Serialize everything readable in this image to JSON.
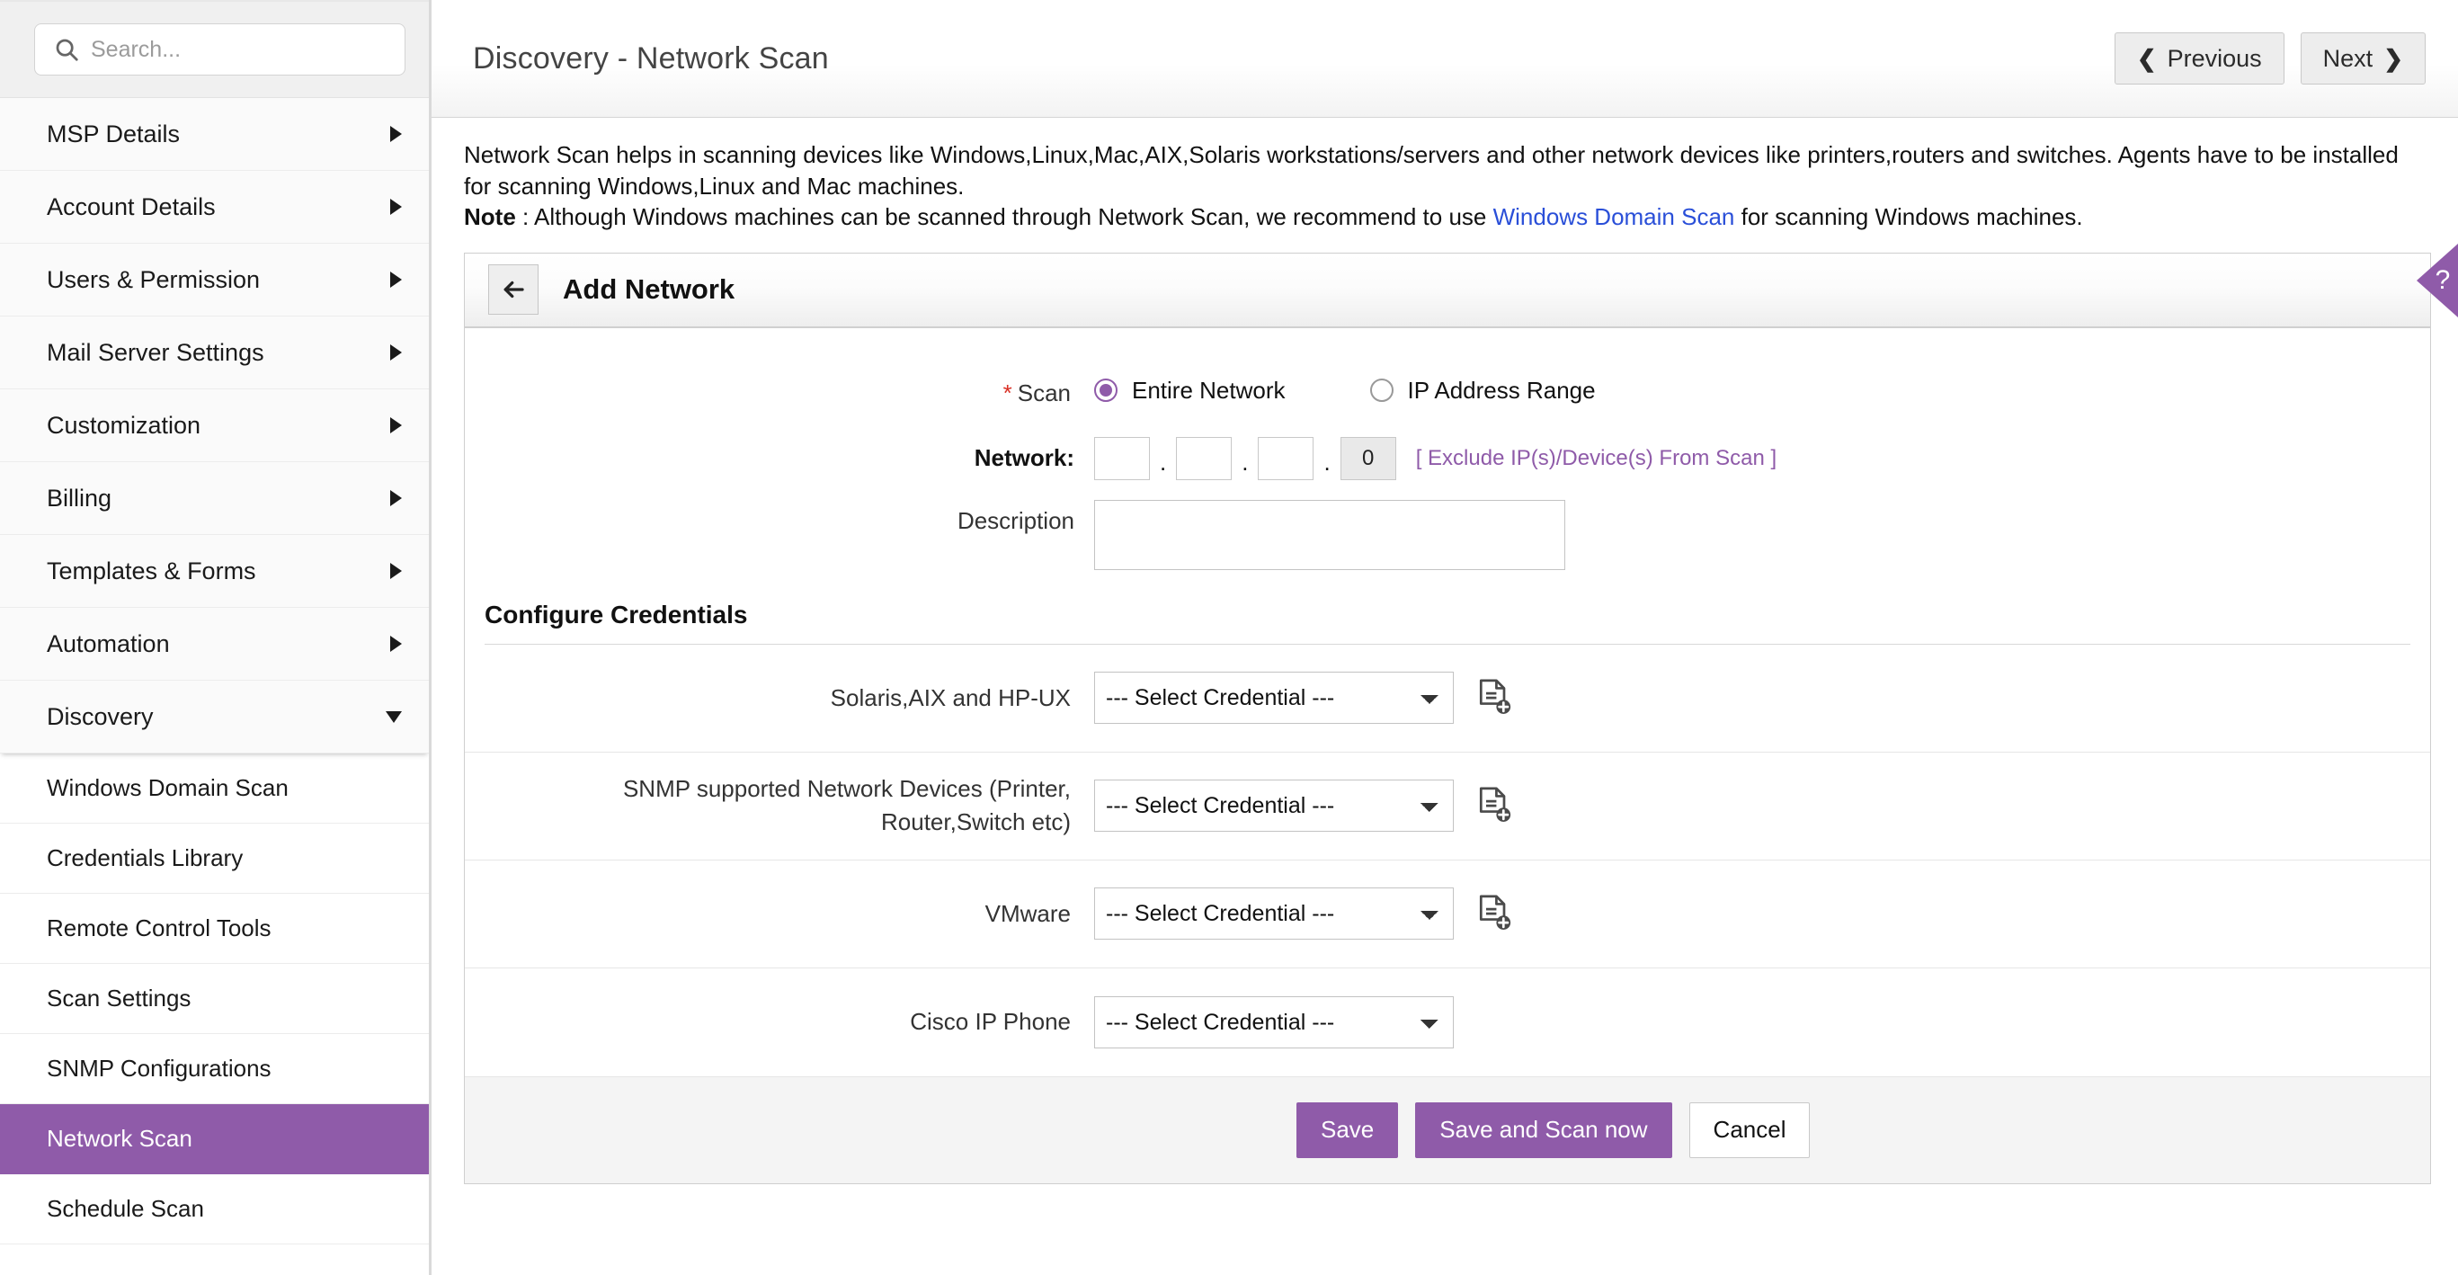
{
  "sidebar": {
    "search": {
      "placeholder": "Search...",
      "value": ""
    },
    "groups": [
      {
        "label": "MSP Details",
        "expanded": false
      },
      {
        "label": "Account Details",
        "expanded": false
      },
      {
        "label": "Users & Permission",
        "expanded": false
      },
      {
        "label": "Mail Server Settings",
        "expanded": false
      },
      {
        "label": "Customization",
        "expanded": false
      },
      {
        "label": "Billing",
        "expanded": false
      },
      {
        "label": "Templates & Forms",
        "expanded": false
      },
      {
        "label": "Automation",
        "expanded": false
      },
      {
        "label": "Discovery",
        "expanded": true
      }
    ],
    "discovery_items": [
      {
        "label": "Windows Domain Scan",
        "active": false
      },
      {
        "label": "Credentials Library",
        "active": false
      },
      {
        "label": "Remote Control Tools",
        "active": false
      },
      {
        "label": "Scan Settings",
        "active": false
      },
      {
        "label": "SNMP Configurations",
        "active": false
      },
      {
        "label": "Network Scan",
        "active": true
      },
      {
        "label": "Schedule Scan",
        "active": false
      }
    ]
  },
  "topbar": {
    "title": "Discovery - Network Scan",
    "previous_label": "Previous",
    "next_label": "Next",
    "previous_chevron": "❮",
    "next_chevron": "❯"
  },
  "help_tab": {
    "glyph": "?"
  },
  "intro": {
    "line1": "Network Scan helps in scanning devices like Windows,Linux,Mac,AIX,Solaris workstations/servers and other network devices like printers,routers and switches. Agents have to be installed for scanning Windows,Linux and Mac machines.",
    "note_label": "Note",
    "note_before": " : Although Windows machines can be scanned through Network Scan, we recommend to use ",
    "note_link": "Windows Domain Scan",
    "note_after": " for scanning Windows machines."
  },
  "card": {
    "title": "Add Network",
    "back_icon": "arrow-left-icon",
    "scan": {
      "label": "Scan",
      "required_mark": "*",
      "options": [
        {
          "label": "Entire Network",
          "selected": true
        },
        {
          "label": "IP Address Range",
          "selected": false
        }
      ]
    },
    "network": {
      "label": "Network:",
      "octets": [
        "",
        "",
        "",
        "0"
      ],
      "separator": ".",
      "exclude_link": "[ Exclude IP(s)/Device(s) From Scan ]"
    },
    "description": {
      "label": "Description",
      "value": "",
      "placeholder": ""
    },
    "credentials_section_title": "Configure Credentials",
    "credentials": [
      {
        "label": "Solaris,AIX and HP-UX",
        "value": "--- Select Credential ---",
        "has_add_icon": true
      },
      {
        "label": "SNMP supported Network Devices (Printer, Router,Switch etc)",
        "value": "--- Select Credential ---",
        "has_add_icon": true
      },
      {
        "label": "VMware",
        "value": "--- Select Credential ---",
        "has_add_icon": true
      },
      {
        "label": "Cisco IP Phone",
        "value": "--- Select Credential ---",
        "has_add_icon": false
      }
    ],
    "select_options": [
      "--- Select Credential ---"
    ],
    "footer": {
      "save_label": "Save",
      "save_scan_label": "Save and Scan now",
      "cancel_label": "Cancel"
    }
  },
  "colors": {
    "accent_purple": "#8f5ba9",
    "required_red": "#d93025",
    "link_blue": "#2a4fd8"
  }
}
